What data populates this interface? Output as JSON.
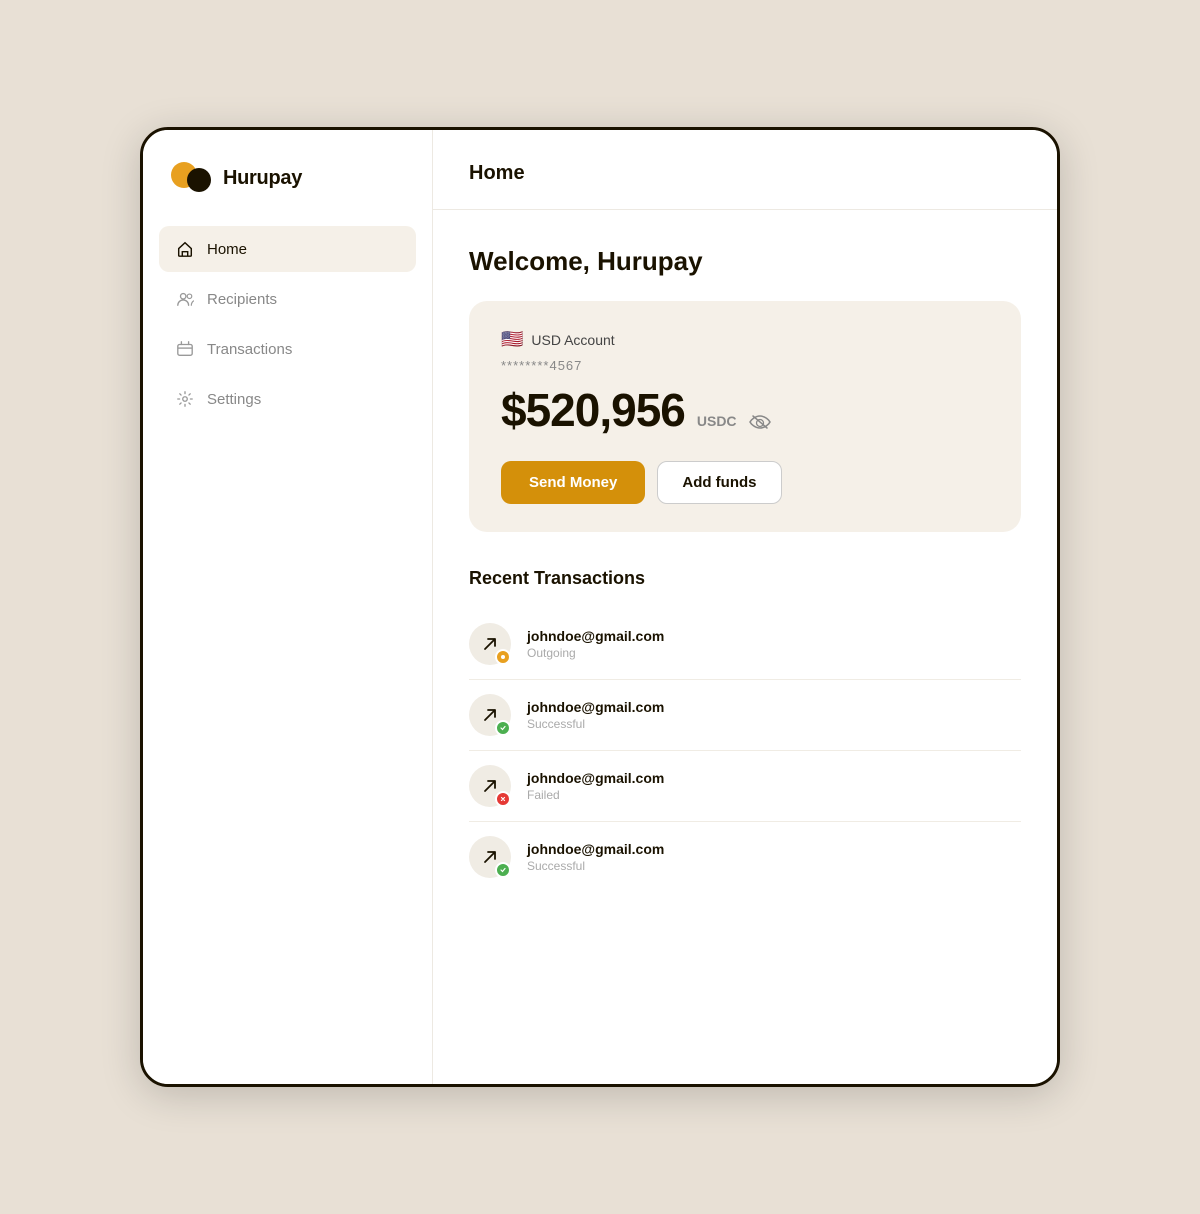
{
  "app": {
    "name": "Hurupay"
  },
  "sidebar": {
    "nav_items": [
      {
        "id": "home",
        "label": "Home",
        "active": true
      },
      {
        "id": "recipients",
        "label": "Recipients",
        "active": false
      },
      {
        "id": "transactions",
        "label": "Transactions",
        "active": false
      },
      {
        "id": "settings",
        "label": "Settings",
        "active": false
      }
    ]
  },
  "header": {
    "title": "Home"
  },
  "main": {
    "welcome": "Welcome, Hurupay",
    "account": {
      "currency_label": "USD Account",
      "account_number": "********4567",
      "balance": "$520,956",
      "currency_code": "USDC"
    },
    "buttons": {
      "send": "Send Money",
      "add": "Add funds"
    },
    "recent_transactions": {
      "title": "Recent Transactions",
      "items": [
        {
          "email": "johndoe@gmail.com",
          "status": "Outgoing",
          "status_type": "pending"
        },
        {
          "email": "johndoe@gmail.com",
          "status": "Successful",
          "status_type": "success"
        },
        {
          "email": "johndoe@gmail.com",
          "status": "Failed",
          "status_type": "failed"
        },
        {
          "email": "johndoe@gmail.com",
          "status": "Successful",
          "status_type": "success"
        }
      ]
    }
  }
}
